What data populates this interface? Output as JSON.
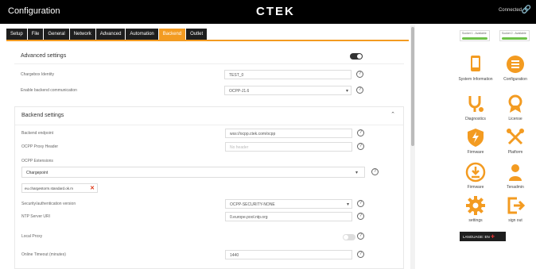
{
  "app": {
    "title": "Configuration",
    "logo": "CTEK",
    "connection": "Connected"
  },
  "tabs": [
    "Setup",
    "File",
    "General",
    "Network",
    "Advanced",
    "Automation",
    "Backend",
    "Outlet"
  ],
  "advanced": {
    "header": "Advanced settings",
    "chargebox_identity_label": "Chargebox Identity",
    "chargebox_identity_value": "TEST_0",
    "ocpp_version_label": "Enable backend communication",
    "ocpp_version_value": "OCPP-J1.6"
  },
  "backend": {
    "header": "Backend settings",
    "endpoint_label": "Backend endpoint",
    "endpoint_value": "wss://ocpp.ctek.com/ocpp",
    "proxy_header_label": "OCPP Proxy Header",
    "proxy_header_placeholder": "No header",
    "extensions_label": "OCPP Extensions",
    "extensions_value": "Chargepoint",
    "chip_text": "eu.chargestorm.standard.ok.m",
    "security_label": "Security/authentication version",
    "security_value": "OCPP-SECURITY-NONE",
    "ntp_label": "NTP Server URI",
    "ntp_value": "0.europe.pool.ntp.org",
    "local_proxy_label": "Local Proxy",
    "ping_label": "Online Timeout (minutes)",
    "ping_value": "1440"
  },
  "sockets": [
    {
      "label": "Socket 1 - Available"
    },
    {
      "label": "Socket 2 - Available"
    }
  ],
  "sidebar": [
    {
      "label": "System Information"
    },
    {
      "label": "Configuration"
    },
    {
      "label": "Diagnostics"
    },
    {
      "label": "License"
    },
    {
      "label": "Firmware"
    },
    {
      "label": "Platform"
    },
    {
      "label": "Firmware"
    },
    {
      "label": "Tenadmin"
    },
    {
      "label": "settings"
    },
    {
      "label": "sign out"
    }
  ],
  "language_label": "LANGUAGE: EN",
  "colors": {
    "accent": "#f39b21",
    "icon": "#f39b21",
    "ok": "#6fc24a",
    "dark": "#1e1e1e"
  }
}
